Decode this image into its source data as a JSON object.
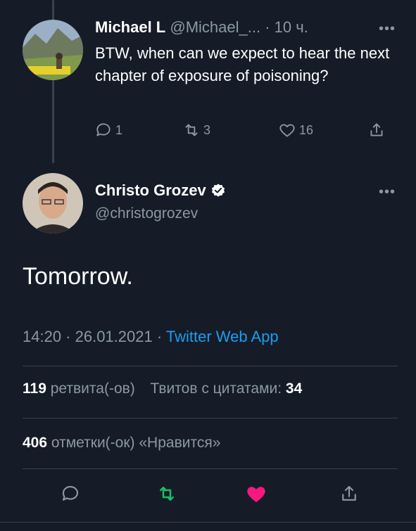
{
  "reply": {
    "name": "Michael L",
    "handle": "@Michael_...",
    "time": "· 10 ч.",
    "more": "•••",
    "text": "BTW, when can we expect to hear the next chapter of exposure of poisoning?",
    "replies": "1",
    "retweets": "3",
    "likes": "16"
  },
  "tweet": {
    "name": "Christo Grozev",
    "handle": "@christogrozev",
    "more": "•••",
    "text": "Tomorrow.",
    "timestamp": "14:20 · 26.01.2021 ·",
    "source": "Twitter Web App",
    "retweet_count": "119",
    "retweet_label": "ретвита(-ов)",
    "quote_label": "Твитов с цитатами:",
    "quote_count": "34",
    "like_count": "406",
    "like_label": "отметки(-ок) «Нравится»"
  },
  "colors": {
    "background": "#151c27",
    "muted": "#8b98a5",
    "link": "#1d9bf0",
    "retweet_active": "#17bf63",
    "like_active": "#f91880",
    "verified": "#ffffff"
  },
  "icons": [
    "reply-icon",
    "retweet-icon",
    "like-icon",
    "share-icon",
    "verified-badge-icon",
    "more-icon"
  ]
}
